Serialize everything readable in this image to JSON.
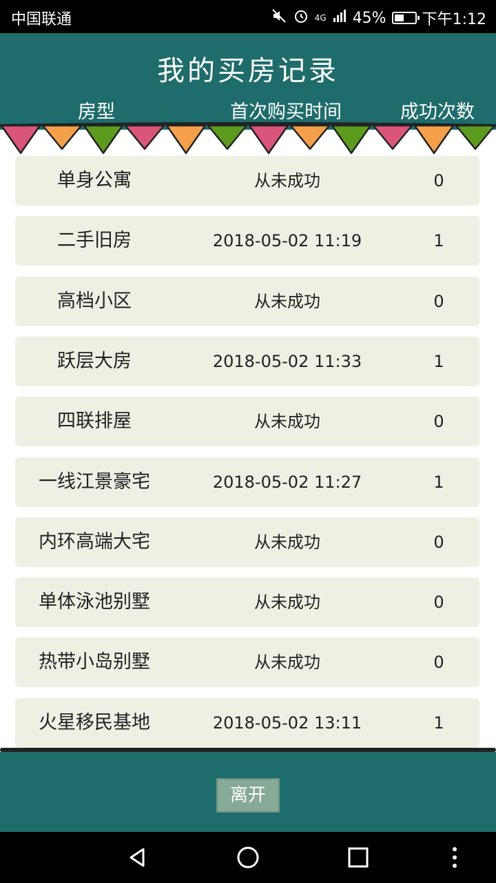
{
  "status_bar": {
    "carrier": "中国联通",
    "network": "4G",
    "battery": "45%",
    "battery_level": 0.45,
    "time": "下午1:12",
    "icons": [
      "mute-icon",
      "alarm-icon",
      "signal-icon",
      "battery-icon"
    ]
  },
  "header": {
    "title": "我的买房记录",
    "columns": [
      "房型",
      "首次购买时间",
      "成功次数"
    ]
  },
  "colors": {
    "header_bg": "#1e6c6c",
    "row_bg": "#eef0e4",
    "button_bg": "#86aa95",
    "bunting": [
      "#d9557a",
      "#f4a04b",
      "#5d9b1e"
    ]
  },
  "records": [
    {
      "type": "单身公寓",
      "time": "从未成功",
      "count": "0"
    },
    {
      "type": "二手旧房",
      "time": "2018-05-02 11:19",
      "count": "1"
    },
    {
      "type": "高档小区",
      "time": "从未成功",
      "count": "0"
    },
    {
      "type": "跃层大房",
      "time": "2018-05-02 11:33",
      "count": "1"
    },
    {
      "type": "四联排屋",
      "time": "从未成功",
      "count": "0"
    },
    {
      "type": "一线江景豪宅",
      "time": "2018-05-02 11:27",
      "count": "1"
    },
    {
      "type": "内环高端大宅",
      "time": "从未成功",
      "count": "0"
    },
    {
      "type": "单体泳池别墅",
      "time": "从未成功",
      "count": "0"
    },
    {
      "type": "热带小岛别墅",
      "time": "从未成功",
      "count": "0"
    },
    {
      "type": "火星移民基地",
      "time": "2018-05-02 13:11",
      "count": "1"
    }
  ],
  "footer": {
    "leave_label": "离开"
  },
  "navbar": {
    "icons": [
      "back-icon",
      "home-icon",
      "recents-icon",
      "more-icon"
    ]
  }
}
